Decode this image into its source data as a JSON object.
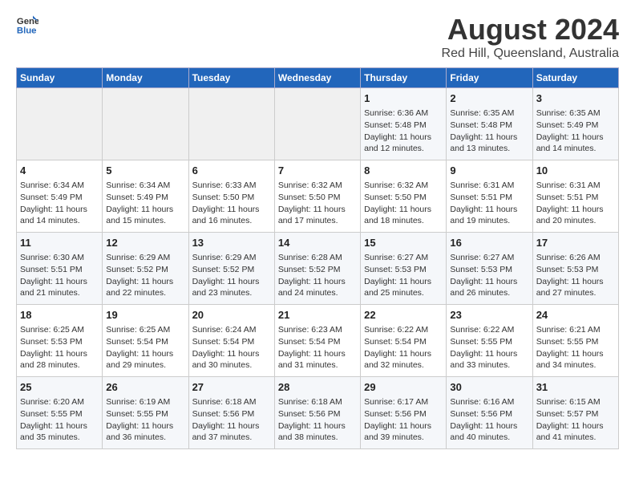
{
  "header": {
    "logo_general": "General",
    "logo_blue": "Blue",
    "title": "August 2024",
    "subtitle": "Red Hill, Queensland, Australia"
  },
  "days_of_week": [
    "Sunday",
    "Monday",
    "Tuesday",
    "Wednesday",
    "Thursday",
    "Friday",
    "Saturday"
  ],
  "weeks": [
    [
      {
        "day": "",
        "info": ""
      },
      {
        "day": "",
        "info": ""
      },
      {
        "day": "",
        "info": ""
      },
      {
        "day": "",
        "info": ""
      },
      {
        "day": "1",
        "info": "Sunrise: 6:36 AM\nSunset: 5:48 PM\nDaylight: 11 hours and 12 minutes."
      },
      {
        "day": "2",
        "info": "Sunrise: 6:35 AM\nSunset: 5:48 PM\nDaylight: 11 hours and 13 minutes."
      },
      {
        "day": "3",
        "info": "Sunrise: 6:35 AM\nSunset: 5:49 PM\nDaylight: 11 hours and 14 minutes."
      }
    ],
    [
      {
        "day": "4",
        "info": "Sunrise: 6:34 AM\nSunset: 5:49 PM\nDaylight: 11 hours and 14 minutes."
      },
      {
        "day": "5",
        "info": "Sunrise: 6:34 AM\nSunset: 5:49 PM\nDaylight: 11 hours and 15 minutes."
      },
      {
        "day": "6",
        "info": "Sunrise: 6:33 AM\nSunset: 5:50 PM\nDaylight: 11 hours and 16 minutes."
      },
      {
        "day": "7",
        "info": "Sunrise: 6:32 AM\nSunset: 5:50 PM\nDaylight: 11 hours and 17 minutes."
      },
      {
        "day": "8",
        "info": "Sunrise: 6:32 AM\nSunset: 5:50 PM\nDaylight: 11 hours and 18 minutes."
      },
      {
        "day": "9",
        "info": "Sunrise: 6:31 AM\nSunset: 5:51 PM\nDaylight: 11 hours and 19 minutes."
      },
      {
        "day": "10",
        "info": "Sunrise: 6:31 AM\nSunset: 5:51 PM\nDaylight: 11 hours and 20 minutes."
      }
    ],
    [
      {
        "day": "11",
        "info": "Sunrise: 6:30 AM\nSunset: 5:51 PM\nDaylight: 11 hours and 21 minutes."
      },
      {
        "day": "12",
        "info": "Sunrise: 6:29 AM\nSunset: 5:52 PM\nDaylight: 11 hours and 22 minutes."
      },
      {
        "day": "13",
        "info": "Sunrise: 6:29 AM\nSunset: 5:52 PM\nDaylight: 11 hours and 23 minutes."
      },
      {
        "day": "14",
        "info": "Sunrise: 6:28 AM\nSunset: 5:52 PM\nDaylight: 11 hours and 24 minutes."
      },
      {
        "day": "15",
        "info": "Sunrise: 6:27 AM\nSunset: 5:53 PM\nDaylight: 11 hours and 25 minutes."
      },
      {
        "day": "16",
        "info": "Sunrise: 6:27 AM\nSunset: 5:53 PM\nDaylight: 11 hours and 26 minutes."
      },
      {
        "day": "17",
        "info": "Sunrise: 6:26 AM\nSunset: 5:53 PM\nDaylight: 11 hours and 27 minutes."
      }
    ],
    [
      {
        "day": "18",
        "info": "Sunrise: 6:25 AM\nSunset: 5:53 PM\nDaylight: 11 hours and 28 minutes."
      },
      {
        "day": "19",
        "info": "Sunrise: 6:25 AM\nSunset: 5:54 PM\nDaylight: 11 hours and 29 minutes."
      },
      {
        "day": "20",
        "info": "Sunrise: 6:24 AM\nSunset: 5:54 PM\nDaylight: 11 hours and 30 minutes."
      },
      {
        "day": "21",
        "info": "Sunrise: 6:23 AM\nSunset: 5:54 PM\nDaylight: 11 hours and 31 minutes."
      },
      {
        "day": "22",
        "info": "Sunrise: 6:22 AM\nSunset: 5:54 PM\nDaylight: 11 hours and 32 minutes."
      },
      {
        "day": "23",
        "info": "Sunrise: 6:22 AM\nSunset: 5:55 PM\nDaylight: 11 hours and 33 minutes."
      },
      {
        "day": "24",
        "info": "Sunrise: 6:21 AM\nSunset: 5:55 PM\nDaylight: 11 hours and 34 minutes."
      }
    ],
    [
      {
        "day": "25",
        "info": "Sunrise: 6:20 AM\nSunset: 5:55 PM\nDaylight: 11 hours and 35 minutes."
      },
      {
        "day": "26",
        "info": "Sunrise: 6:19 AM\nSunset: 5:55 PM\nDaylight: 11 hours and 36 minutes."
      },
      {
        "day": "27",
        "info": "Sunrise: 6:18 AM\nSunset: 5:56 PM\nDaylight: 11 hours and 37 minutes."
      },
      {
        "day": "28",
        "info": "Sunrise: 6:18 AM\nSunset: 5:56 PM\nDaylight: 11 hours and 38 minutes."
      },
      {
        "day": "29",
        "info": "Sunrise: 6:17 AM\nSunset: 5:56 PM\nDaylight: 11 hours and 39 minutes."
      },
      {
        "day": "30",
        "info": "Sunrise: 6:16 AM\nSunset: 5:56 PM\nDaylight: 11 hours and 40 minutes."
      },
      {
        "day": "31",
        "info": "Sunrise: 6:15 AM\nSunset: 5:57 PM\nDaylight: 11 hours and 41 minutes."
      }
    ]
  ]
}
